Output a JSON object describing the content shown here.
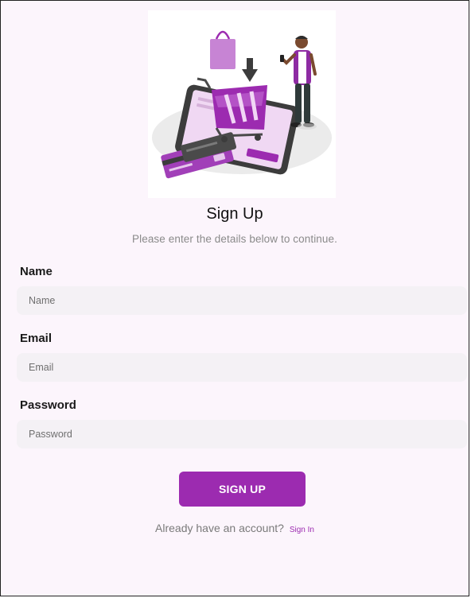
{
  "colors": {
    "accent": "#9c2bb0",
    "background": "#fcf5fc",
    "input_bg": "#f4f1f5"
  },
  "hero": {
    "illustration": "online-shopping-illustration"
  },
  "header": {
    "title": "Sign Up",
    "subtitle": "Please enter the details below to continue."
  },
  "form": {
    "name": {
      "label": "Name",
      "placeholder": "Name",
      "value": ""
    },
    "email": {
      "label": "Email",
      "placeholder": "Email",
      "value": ""
    },
    "password": {
      "label": "Password",
      "placeholder": "Password",
      "value": ""
    },
    "submit_label": "SIGN UP"
  },
  "footer": {
    "prompt": "Already have an account?",
    "link_label": "Sign In"
  }
}
